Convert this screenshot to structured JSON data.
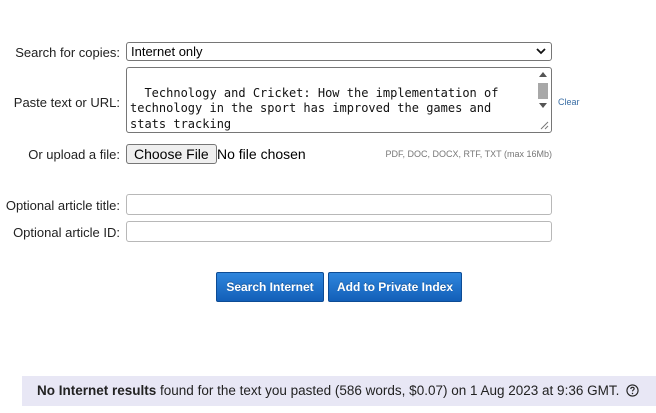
{
  "form": {
    "search_label": "Search for copies:",
    "search_selected": "Internet only",
    "paste_label": "Paste text or URL:",
    "paste_value": "Technology and Cricket: How the implementation of technology in the sport has improved the games and stats tracking",
    "clear_label": "Clear",
    "upload_label": "Or upload a file:",
    "choose_file_label": "Choose File",
    "file_status": "No file chosen",
    "file_hint": "PDF, DOC, DOCX, RTF, TXT (max 16Mb)",
    "title_label": "Optional article title:",
    "title_value": "",
    "id_label": "Optional article ID:",
    "id_value": ""
  },
  "buttons": {
    "search_internet": "Search Internet",
    "add_private": "Add to Private Index"
  },
  "result": {
    "bold_text": "No Internet results",
    "rest_text": " found for the text you pasted (586 words, $0.07) on 1 Aug 2023 at 9:36 GMT."
  },
  "icons": {
    "select_chevron": "chevron-down-icon",
    "help": "help-circle-icon"
  },
  "colors": {
    "button_blue": "#1b6fc8",
    "result_bg": "#e8e7f5",
    "link": "#3a6ea5"
  }
}
